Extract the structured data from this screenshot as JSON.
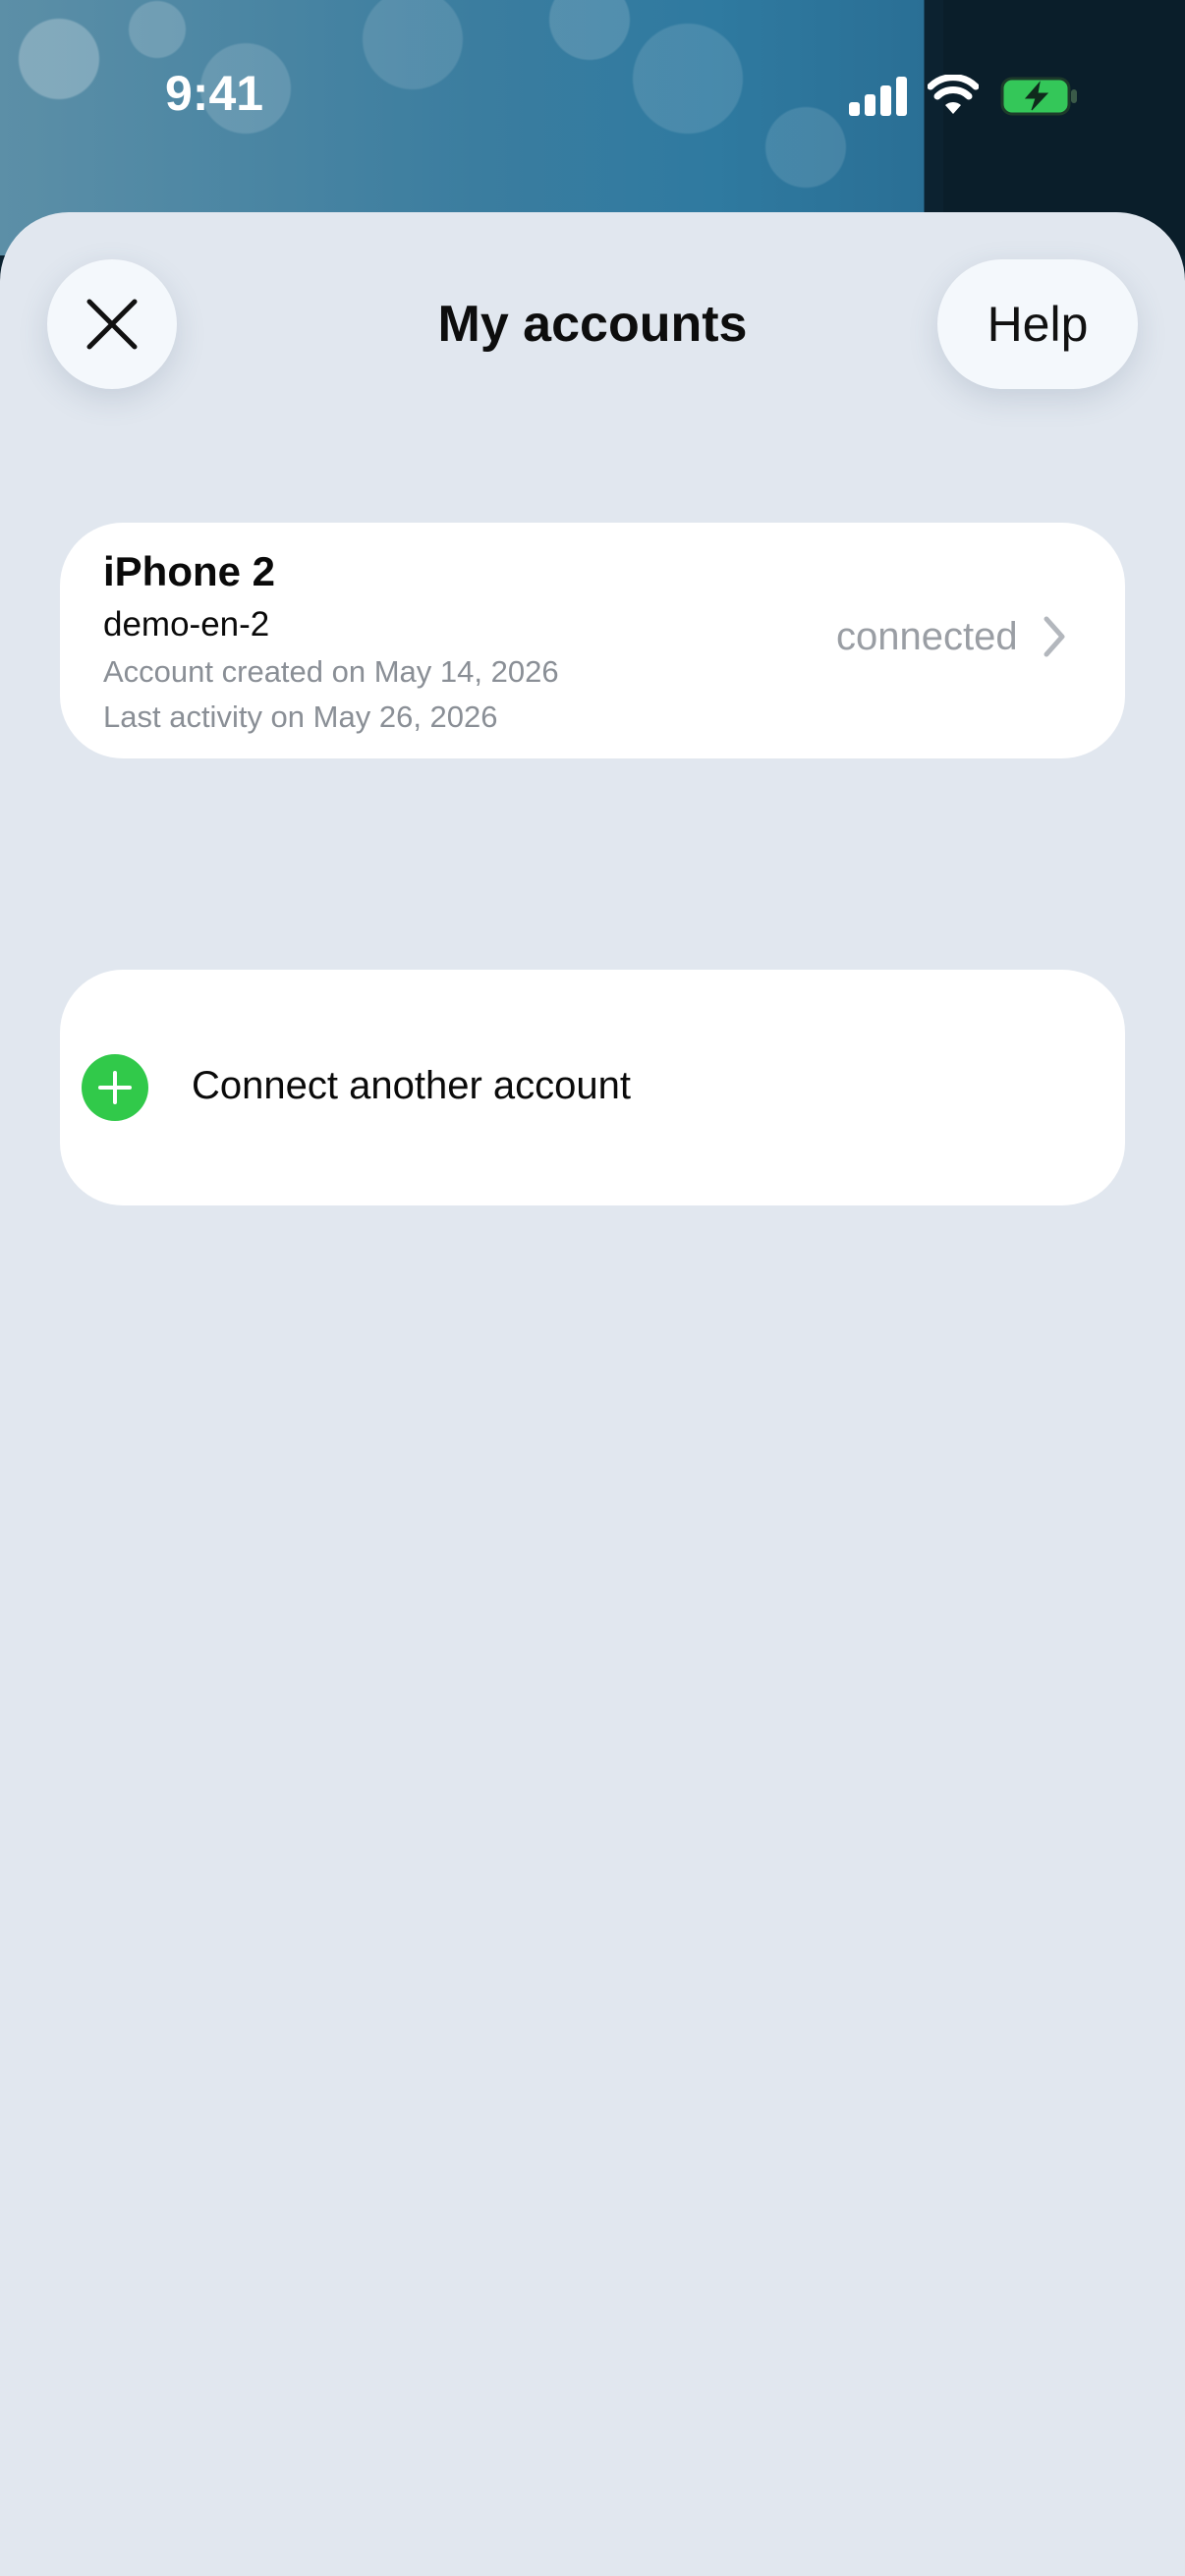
{
  "status_bar": {
    "time": "9:41",
    "icons": [
      "cellular-signal-icon",
      "wifi-icon",
      "battery-charging-icon"
    ]
  },
  "header": {
    "title": "My accounts",
    "close_icon": "close-icon",
    "help_label": "Help"
  },
  "accounts": [
    {
      "name": "iPhone 2",
      "username": "demo-en-2",
      "created": "Account created on May 14, 2026",
      "last_activity": "Last activity on May 26, 2026",
      "status": "connected"
    }
  ],
  "connect": {
    "label": "Connect another account",
    "icon": "plus-icon"
  },
  "colors": {
    "sheet_background": "#e1e7ef",
    "card_background": "#ffffff",
    "accent_green": "#31c94a",
    "battery_green": "#34c759"
  }
}
